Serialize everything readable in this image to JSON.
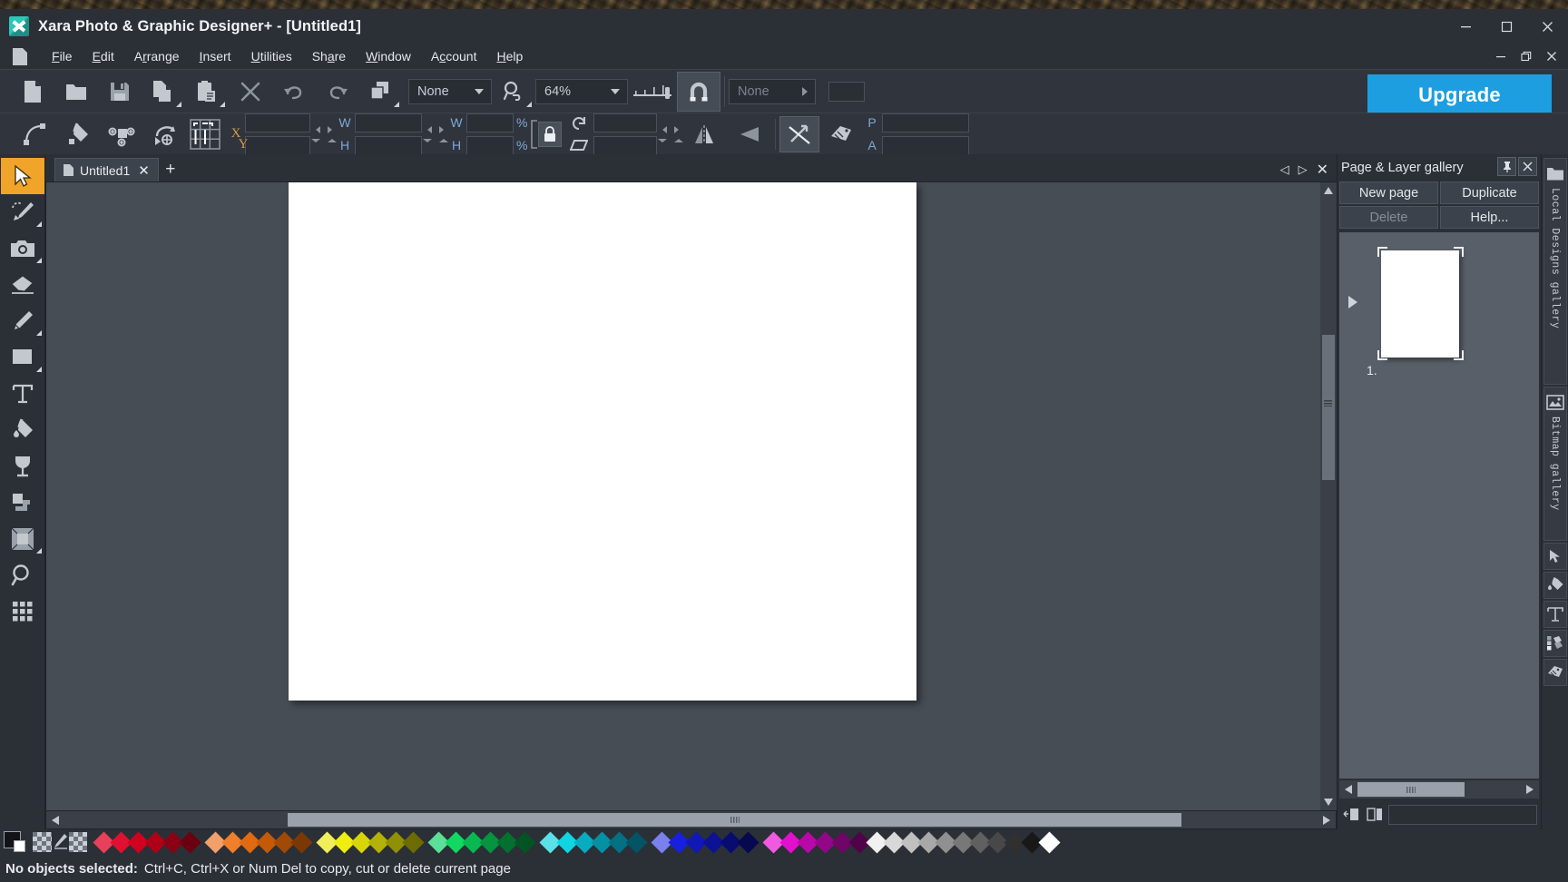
{
  "window": {
    "title": "Xara Photo & Graphic Designer+ - [Untitled1]",
    "minimize": "–",
    "maximize": "❐",
    "close": "✕"
  },
  "menubar": {
    "items": [
      {
        "label": "File",
        "accel": "F"
      },
      {
        "label": "Edit",
        "accel": "E"
      },
      {
        "label": "Arrange",
        "accel": "r"
      },
      {
        "label": "Insert",
        "accel": "I"
      },
      {
        "label": "Utilities",
        "accel": "U"
      },
      {
        "label": "Share",
        "accel": "a"
      },
      {
        "label": "Window",
        "accel": "W"
      },
      {
        "label": "Account",
        "accel": "A"
      },
      {
        "label": "Help",
        "accel": "H"
      }
    ],
    "doc_minimize": "–",
    "doc_restore": "❐",
    "doc_close": "✕"
  },
  "toolbar_main": {
    "buttons": [
      {
        "name": "new-document-button",
        "title": "New"
      },
      {
        "name": "open-document-button",
        "title": "Open"
      },
      {
        "name": "save-document-button",
        "title": "Save"
      },
      {
        "name": "copy-button",
        "title": "Copy"
      },
      {
        "name": "paste-button",
        "title": "Paste"
      },
      {
        "name": "delete-button",
        "title": "Delete"
      },
      {
        "name": "undo-button",
        "title": "Undo"
      },
      {
        "name": "redo-button",
        "title": "Redo"
      },
      {
        "name": "duplicate-button",
        "title": "Duplicate"
      }
    ],
    "quality_value": "None",
    "zoom_value": "64%",
    "snap_enabled": true,
    "page_select_value": "None"
  },
  "toolbar_properties": {
    "buttons": [
      {
        "name": "shape-editor-tool-button"
      },
      {
        "name": "fill-tool-button"
      },
      {
        "name": "transparency-tool-button"
      },
      {
        "name": "rotate-tool-button"
      }
    ],
    "anchor_label": "anchor-grid",
    "x_label": "X",
    "y_label": "Y",
    "x_value": "",
    "y_value": "",
    "w_label": "W",
    "h_label": "H",
    "w_value": "",
    "h_value": "",
    "w2_label": "W",
    "h2_label": "H",
    "w2_value": "",
    "h2_value": "",
    "pct1": "%",
    "pct2": "%",
    "lock_enabled": true,
    "rotate_value": "",
    "skew_value": "",
    "p_label": "P",
    "a_label": "A",
    "p_value": "",
    "a_value": ""
  },
  "upgrade_button": "Upgrade",
  "tools": [
    {
      "name": "selector-tool",
      "label": "Selector Tool",
      "active": true,
      "arrow": false
    },
    {
      "name": "photo-edit-tool",
      "label": "Photo Edit Tool",
      "active": false,
      "arrow": true
    },
    {
      "name": "camera-tool",
      "label": "Photo Tool",
      "active": false,
      "arrow": true
    },
    {
      "name": "eraser-tool",
      "label": "Eraser Tool",
      "active": false,
      "arrow": false
    },
    {
      "name": "freehand-tool",
      "label": "Freehand and Brush Tool",
      "active": false,
      "arrow": true
    },
    {
      "name": "rectangle-tool",
      "label": "Rectangle Tool",
      "active": false,
      "arrow": true
    },
    {
      "name": "text-tool",
      "label": "Text Tool",
      "active": false,
      "arrow": false
    },
    {
      "name": "fill-tool",
      "label": "Fill Tool",
      "active": false,
      "arrow": false
    },
    {
      "name": "transparency-tool",
      "label": "Transparency Tool",
      "active": false,
      "arrow": false
    },
    {
      "name": "shadow-tool",
      "label": "Shadow Tool",
      "active": false,
      "arrow": false
    },
    {
      "name": "bevel-tool",
      "label": "Bevel Tool",
      "active": false,
      "arrow": true
    },
    {
      "name": "zoom-tool",
      "label": "Zoom Tool",
      "active": false,
      "arrow": false
    },
    {
      "name": "grid-tool",
      "label": "Page and Grid Tool",
      "active": false,
      "arrow": false
    }
  ],
  "document_tabs": {
    "tabs": [
      {
        "label": "Untitled1",
        "close": "✕"
      }
    ],
    "add_label": "+",
    "nav_prev": "◁",
    "nav_next": "▷",
    "nav_close": "✕"
  },
  "canvas": {
    "zoom": "64%",
    "page_visible": true
  },
  "right_panel": {
    "title": "Page & Layer gallery",
    "pin_icon": "pin-icon",
    "close_icon": "close-icon",
    "commands": [
      {
        "label": "New  page",
        "name": "new-page-button",
        "dim": false
      },
      {
        "label": "Duplicate",
        "name": "duplicate-page-button",
        "dim": false
      },
      {
        "label": "Delete",
        "name": "delete-page-button",
        "dim": true
      },
      {
        "label": "Help...",
        "name": "help-button",
        "dim": false
      }
    ],
    "page_item_number": "1."
  },
  "gallery_rail": [
    {
      "name": "local-designs-gallery-tab",
      "label": "Local Designs gallery",
      "icon": "folder-icon"
    },
    {
      "name": "bitmap-gallery-tab",
      "label": "Bitmap gallery",
      "icon": "image-icon"
    },
    {
      "name": "clipart-gallery-tab",
      "label": "",
      "icon": "cursor-icon"
    },
    {
      "name": "fill-gallery-tab",
      "label": "",
      "icon": "fill-icon"
    },
    {
      "name": "font-gallery-tab",
      "label": "",
      "icon": "text-icon"
    },
    {
      "name": "color-gallery-tab",
      "label": "",
      "icon": "palette-icon"
    },
    {
      "name": "name-gallery-tab",
      "label": "",
      "icon": "tags-icon"
    }
  ],
  "color_line": {
    "current_fill": "#000000",
    "current_line": "#ffffff",
    "no_color_label": "none",
    "swatches": [
      "#e8405a",
      "#e01030",
      "#d00020",
      "#b00018",
      "#8c0014",
      "#6a0010",
      "#f2a06a",
      "#ef7f2a",
      "#e06a10",
      "#c45a08",
      "#a04a06",
      "#7a3804",
      "#f0ef5a",
      "#efee10",
      "#d8d608",
      "#b4b206",
      "#909004",
      "#6c6c03",
      "#5ae098",
      "#10d860",
      "#08b850",
      "#069440",
      "#047030",
      "#035424",
      "#5ae0e8",
      "#10d4e0",
      "#08acc0",
      "#0690a4",
      "#047084",
      "#035464",
      "#7a80ec",
      "#1820e0",
      "#1018b8",
      "#0c1294",
      "#080c70",
      "#060850",
      "#ef5ae0",
      "#e010cc",
      "#b808a8",
      "#940688",
      "#700468",
      "#500348",
      "#f0f0f0",
      "#d8d8d8",
      "#c0c0c0",
      "#a8a8a8",
      "#909090",
      "#787878",
      "#606060",
      "#484848",
      "#303030",
      "#181818"
    ]
  },
  "status_bar": {
    "prefix": "No objects selected:",
    "message": "Ctrl+C, Ctrl+X or Num Del to copy, cut or delete current page"
  }
}
